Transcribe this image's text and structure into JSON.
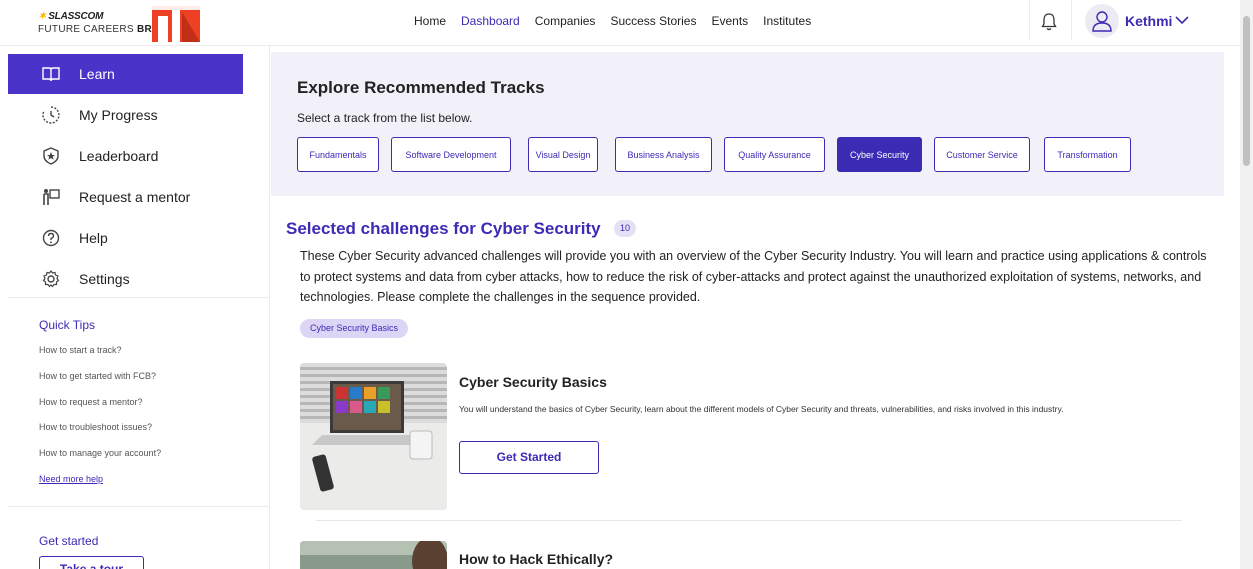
{
  "header": {
    "logo_top": "SLASSCOM",
    "logo_bottom_prefix": "FUTURE CAREERS ",
    "logo_bottom_bold": "BRIDGE",
    "nav": [
      "Home",
      "Dashboard",
      "Companies",
      "Success Stories",
      "Events",
      "Institutes"
    ],
    "active_nav": "Dashboard",
    "username": "Kethmi",
    "icons": [
      "bell-icon",
      "user-icon",
      "chevron-down-icon"
    ]
  },
  "sidebar": {
    "items": [
      {
        "label": "Learn",
        "icon": "book-icon",
        "active": true
      },
      {
        "label": "My Progress",
        "icon": "progress-icon",
        "active": false
      },
      {
        "label": "Leaderboard",
        "icon": "shield-star-icon",
        "active": false
      },
      {
        "label": "Request a mentor",
        "icon": "mentor-icon",
        "active": false
      },
      {
        "label": "Help",
        "icon": "help-icon",
        "active": false
      },
      {
        "label": "Settings",
        "icon": "gear-icon",
        "active": false
      }
    ],
    "quick_tips_title": "Quick Tips",
    "tips": [
      "How to start a track?",
      "How to get started with FCB?",
      "How to request a mentor?",
      "How to troubleshoot issues?",
      "How to manage your account?"
    ],
    "need_help": "Need more help",
    "get_started_label": "Get started",
    "tour_button": "Take a tour"
  },
  "tracks": {
    "title": "Explore Recommended Tracks",
    "subtitle": "Select a track from the list below.",
    "items": [
      "Fundamentals",
      "Software Development",
      "Visual Design",
      "Business Analysis",
      "Quality Assurance",
      "Cyber Security",
      "Customer Service",
      "Transformation"
    ],
    "active": "Cyber Security"
  },
  "challenges": {
    "title": "Selected challenges for Cyber Security",
    "count": "10",
    "description": "These Cyber Security advanced challenges will provide you with an overview of the Cyber Security Industry. You will learn and practice using applications & controls to protect systems and data from cyber attacks, how to reduce the risk of cyber-attacks and protect against the unauthorized exploitation of systems, networks, and technologies. Please complete the challenges in the sequence provided.",
    "chip": "Cyber Security Basics",
    "cards": [
      {
        "title": "Cyber Security Basics",
        "description": "You will understand the basics of Cyber Security, learn about the different models of Cyber Security and threats, vulnerabilities, and risks involved in this industry.",
        "button": "Get Started"
      },
      {
        "title": "How to Hack Ethically?"
      }
    ]
  },
  "colors": {
    "accent": "#3b2bb5",
    "sidebar_active": "#4a33c8",
    "panel_bg": "#f2f1fa",
    "chip_bg": "#dcd5f5"
  }
}
